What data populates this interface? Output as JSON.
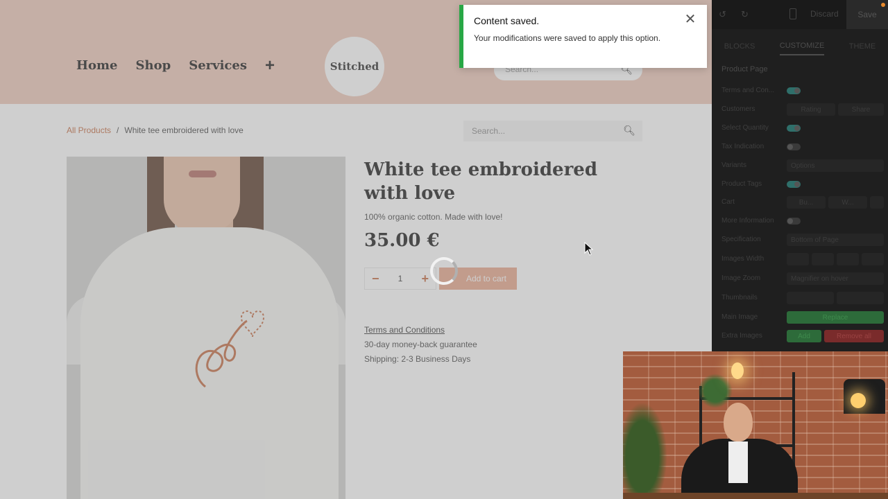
{
  "site": {
    "nav": [
      "Home",
      "Shop",
      "Services"
    ],
    "nav_plus": "+",
    "logo_text": "Stitched",
    "header_search_placeholder": "Search...",
    "breadcrumb": {
      "link": "All Products",
      "sep": "/",
      "current": "White tee embroidered with love"
    },
    "page_search_placeholder": "Search...",
    "product": {
      "title": "White tee embroidered with love",
      "subtitle": "100% organic cotton. Made with love!",
      "price": "35.00 €",
      "quantity": "1",
      "qty_minus": "−",
      "qty_plus": "+",
      "add_to_cart": "Add to cart",
      "terms": "Terms and Conditions",
      "guarantee": "30-day money-back guarantee",
      "shipping": "Shipping: 2-3 Business Days"
    }
  },
  "toast": {
    "title": "Content saved.",
    "message": "Your modifications were saved to apply this option.",
    "status_color": "#28a745"
  },
  "editor": {
    "toolbar": {
      "discard": "Discard",
      "save": "Save"
    },
    "tabs": [
      "BLOCKS",
      "CUSTOMIZE",
      "THEME"
    ],
    "active_tab": "CUSTOMIZE",
    "section": "Product Page",
    "rows": {
      "terms": "Terms and Con...",
      "customers": "Customers",
      "customers_opt1": "Rating",
      "customers_opt2": "Share",
      "select_quantity": "Select Quantity",
      "tax_indication": "Tax Indication",
      "variants": "Variants",
      "variants_value": "Options",
      "product_tags": "Product Tags",
      "cart": "Cart",
      "cart_opt1": "Bu...",
      "cart_opt2": "W...",
      "more_information": "More Information",
      "specification": "Specification",
      "specification_value": "Bottom of Page",
      "images_width": "Images Width",
      "image_zoom": "Image Zoom",
      "image_zoom_value": "Magnifier on hover",
      "thumbnails": "Thumbnails",
      "main_image": "Main Image",
      "main_image_btn": "Replace",
      "extra_images": "Extra Images",
      "extra_add": "Add",
      "extra_remove": "Remove all"
    }
  },
  "icons": [
    "undo-icon",
    "redo-icon",
    "mobile-icon",
    "save-icon",
    "close-icon",
    "search-icon",
    "spinner-icon",
    "cursor-icon"
  ]
}
